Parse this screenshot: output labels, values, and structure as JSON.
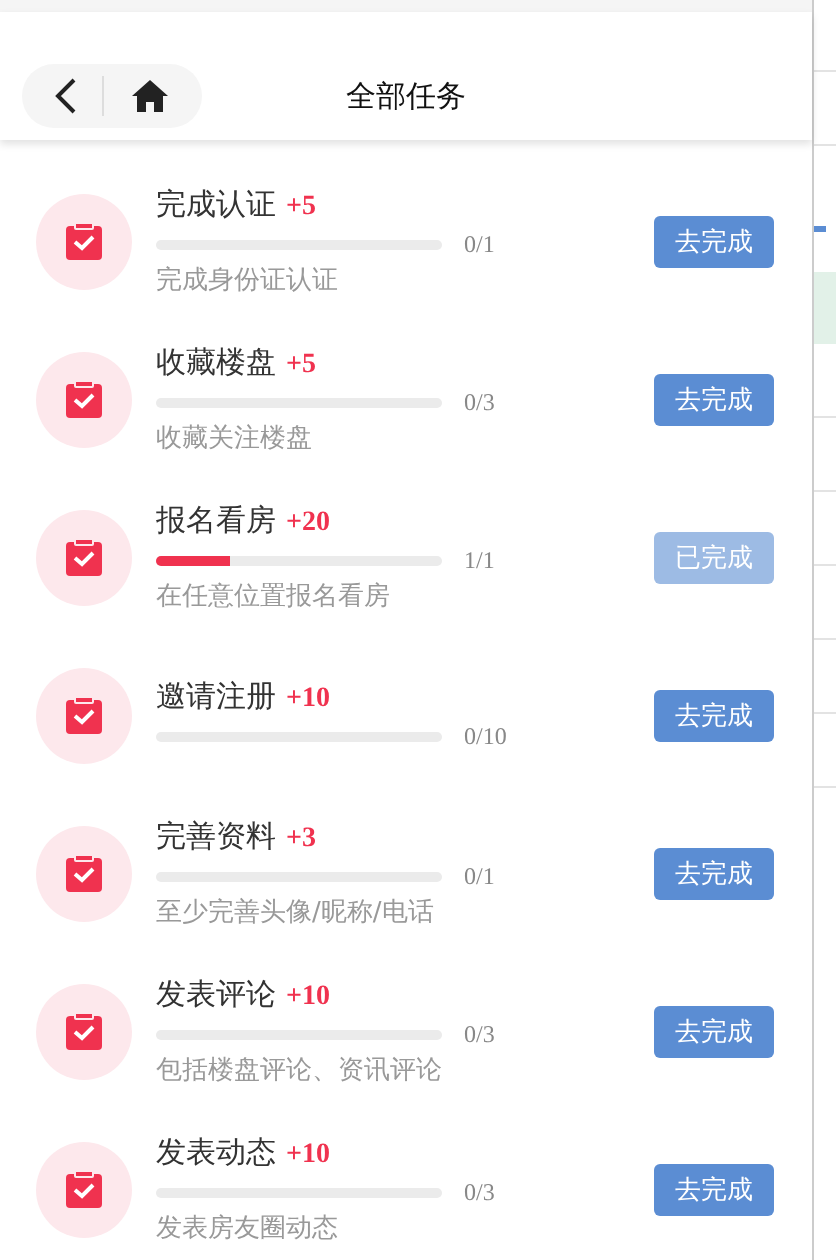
{
  "header": {
    "title": "全部任务"
  },
  "tasks": [
    {
      "title": "完成认证",
      "points": "+5",
      "count": "0/1",
      "subtitle": "完成身份证认证",
      "button": "去完成",
      "done": false
    },
    {
      "title": "收藏楼盘",
      "points": "+5",
      "count": "0/3",
      "subtitle": "收藏关注楼盘",
      "button": "去完成",
      "done": false
    },
    {
      "title": "报名看房",
      "points": "+20",
      "level": 0.26,
      "count": "1/1",
      "subtitle": "在任意位置报名看房",
      "button": "已完成",
      "done": true
    },
    {
      "title": "邀请注册",
      "points": "+10",
      "count": "0/10",
      "button": "去完成",
      "done": false
    },
    {
      "title": "完善资料",
      "points": "+3",
      "count": "0/1",
      "subtitle": "至少完善头像/昵称/电话",
      "button": "去完成",
      "done": false
    },
    {
      "title": "发表评论",
      "points": "+10",
      "count": "0/3",
      "subtitle": "包括楼盘评论、资讯评论",
      "button": "去完成",
      "done": false
    },
    {
      "title": "发表动态",
      "points": "+10",
      "count": "0/3",
      "subtitle": "发表房友圈动态",
      "button": "去完成",
      "done": false
    }
  ]
}
